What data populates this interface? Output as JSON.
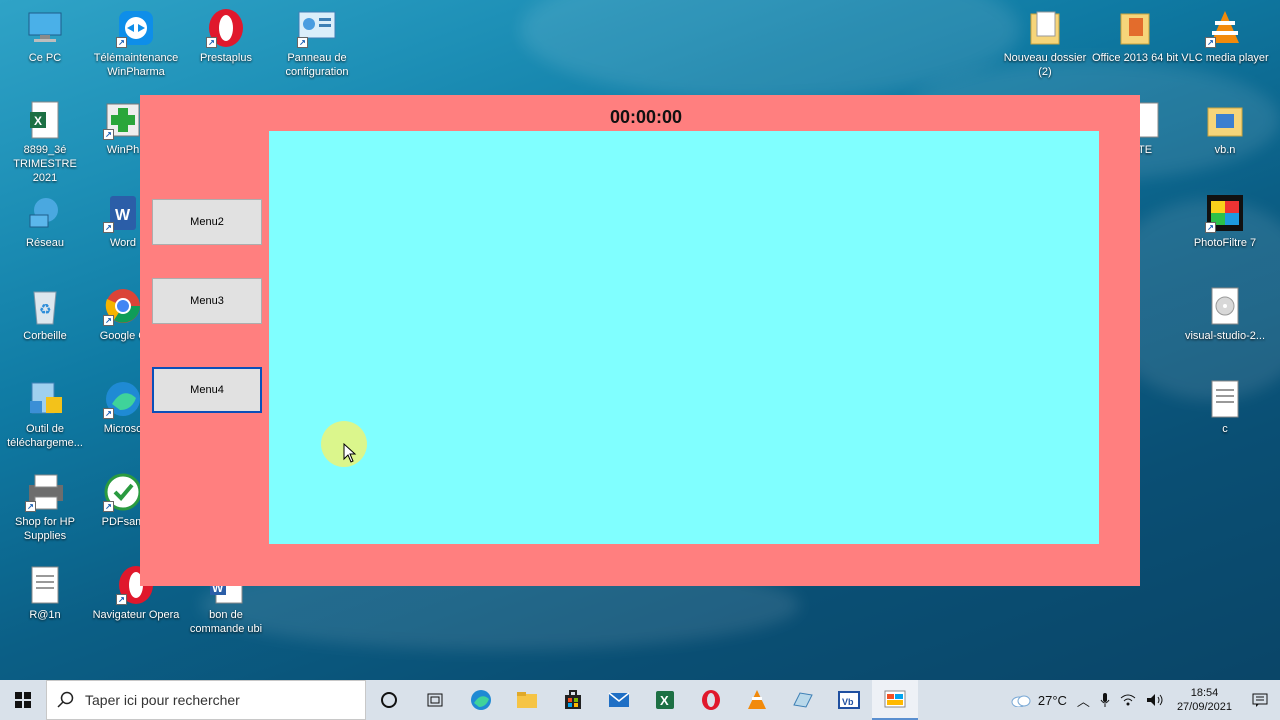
{
  "desktop": {
    "icons": [
      {
        "label": "Ce PC",
        "icon": "computer-icon"
      },
      {
        "label": "Télémaintenance WinPharma",
        "icon": "teamviewer-icon"
      },
      {
        "label": "Prestaplus",
        "icon": "opera-icon"
      },
      {
        "label": "Panneau de configuration",
        "icon": "control-panel-icon"
      },
      {
        "label": "Nouveau dossier (2)",
        "icon": "folder-icon"
      },
      {
        "label": "Office 2013 64 bit",
        "icon": "folder-icon"
      },
      {
        "label": "VLC media player",
        "icon": "vlc-icon"
      },
      {
        "label": "8899_3é TRIMESTRE 2021",
        "icon": "excel-file-icon"
      },
      {
        "label": "WinPh",
        "icon": "winpharma-icon"
      },
      {
        "label": "TE",
        "icon": "file-icon"
      },
      {
        "label": "vb.n",
        "icon": "folder-icon"
      },
      {
        "label": "Réseau",
        "icon": "network-icon"
      },
      {
        "label": "Word",
        "icon": "word-icon"
      },
      {
        "label": "PhotoFiltre 7",
        "icon": "photofiltre-icon"
      },
      {
        "label": "Corbeille",
        "icon": "recycle-bin-icon"
      },
      {
        "label": "Google C",
        "icon": "chrome-icon"
      },
      {
        "label": "visual-studio-2...",
        "icon": "disc-image-icon"
      },
      {
        "label": "Outil de téléchargeme...",
        "icon": "download-tool-icon"
      },
      {
        "label": "Microso",
        "icon": "edge-icon"
      },
      {
        "label": "c",
        "icon": "text-file-icon"
      },
      {
        "label": "Shop for HP Supplies",
        "icon": "printer-icon"
      },
      {
        "label": "PDFsam",
        "icon": "pdfsam-icon"
      },
      {
        "label": "R@1n",
        "icon": "text-file-icon"
      },
      {
        "label": "Navigateur Opera",
        "icon": "opera-icon"
      },
      {
        "label": "bon de commande ubi",
        "icon": "word-file-icon"
      }
    ]
  },
  "app": {
    "timer": "00:00:00",
    "background_color": "#ff7f7f",
    "panel_color": "#80ffff",
    "menu_buttons": [
      {
        "label": "Menu2",
        "focused": false
      },
      {
        "label": "Menu3",
        "focused": false
      },
      {
        "label": "Menu4",
        "focused": true
      }
    ]
  },
  "taskbar": {
    "search_placeholder": "Taper ici pour rechercher",
    "apps": [
      "cortana-icon",
      "task-view-icon",
      "edge-icon",
      "file-explorer-icon",
      "store-icon",
      "mail-icon",
      "excel-icon",
      "opera-icon",
      "vlc-icon",
      "app-icon",
      "visual-basic-icon",
      "running-app-icon"
    ],
    "weather": "27°C",
    "time": "18:54",
    "date": "27/09/2021"
  }
}
